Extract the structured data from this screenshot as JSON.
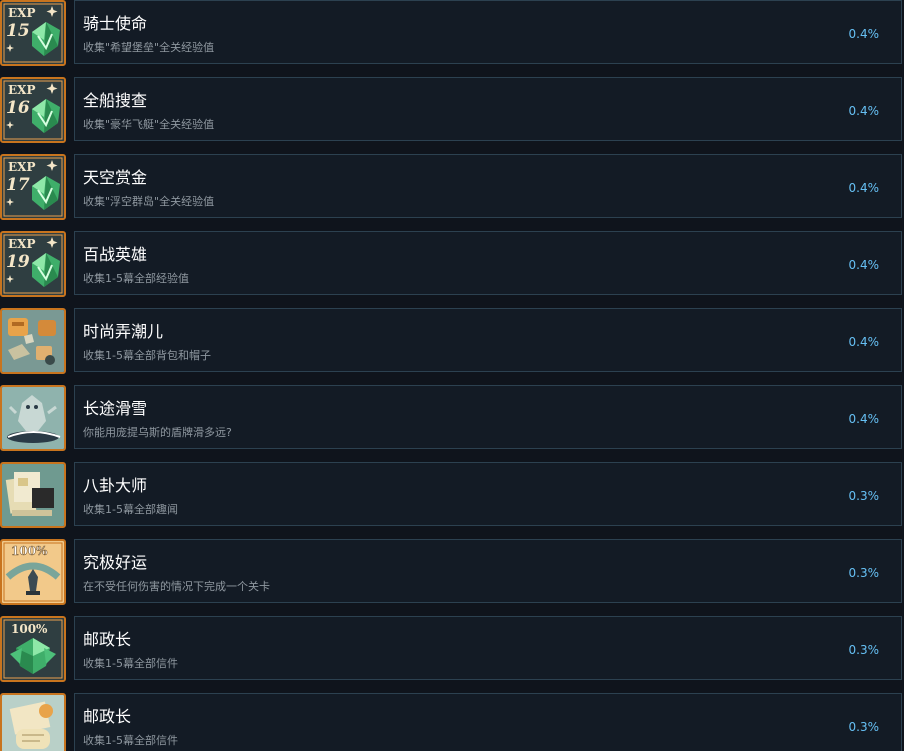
{
  "achievements": [
    {
      "title": "骑士使命",
      "description": "收集\"希望堡垒\"全关经验值",
      "percent": "0.4%",
      "icon": "exp-15-gem-icon",
      "badge_text": "EXP",
      "badge_number": "15"
    },
    {
      "title": "全船搜查",
      "description": "收集\"豪华飞艇\"全关经验值",
      "percent": "0.4%",
      "icon": "exp-16-gem-icon",
      "badge_text": "EXP",
      "badge_number": "16"
    },
    {
      "title": "天空赏金",
      "description": "收集\"浮空群岛\"全关经验值",
      "percent": "0.4%",
      "icon": "exp-17-gem-icon",
      "badge_text": "EXP",
      "badge_number": "17"
    },
    {
      "title": "百战英雄",
      "description": "收集1-5幕全部经验值",
      "percent": "0.4%",
      "icon": "exp-19-gem-icon",
      "badge_text": "EXP",
      "badge_number": "19"
    },
    {
      "title": "时尚弄潮儿",
      "description": "收集1-5幕全部背包和帽子",
      "percent": "0.4%",
      "icon": "backpacks-hats-icon"
    },
    {
      "title": "长途滑雪",
      "description": "你能用庞提乌斯的盾牌滑多远?",
      "percent": "0.4%",
      "icon": "shield-sledding-icon"
    },
    {
      "title": "八卦大师",
      "description": "收集1-5幕全部趣闻",
      "percent": "0.3%",
      "icon": "trivia-papers-icon"
    },
    {
      "title": "究极好运",
      "description": "在不受任何伤害的情况下完成一个关卡",
      "percent": "0.3%",
      "icon": "perfect-health-icon",
      "badge_text": "100%"
    },
    {
      "title": "邮政长",
      "description": "收集1-5幕全部信件",
      "percent": "0.3%",
      "icon": "hundred-percent-gem-icon",
      "badge_text": "100%"
    },
    {
      "title": "邮政长",
      "description": "收集1-5幕全部信件",
      "percent": "0.3%",
      "icon": "letters-scroll-icon"
    }
  ],
  "colors": {
    "background": "#0f141c",
    "panel": "#131b25",
    "panel_border": "#2c4150",
    "percent": "#66c0f4",
    "description": "#8f98a0",
    "icon_border": "#c8741e"
  }
}
